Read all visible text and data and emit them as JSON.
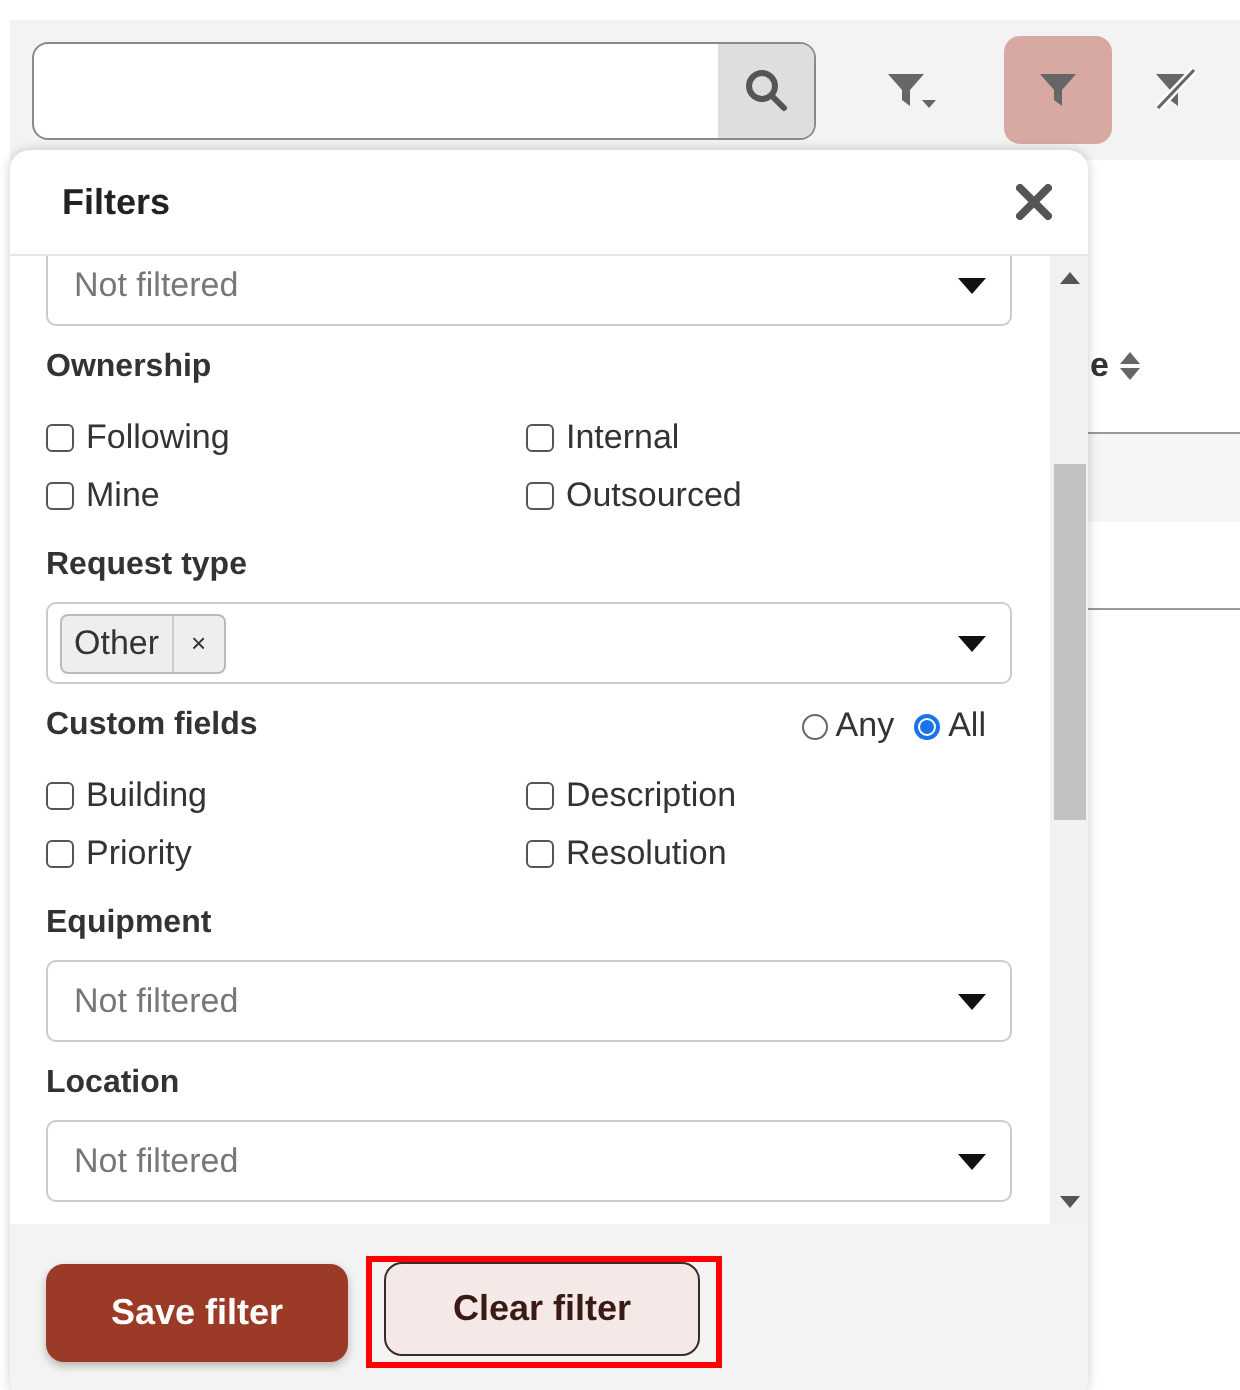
{
  "toolbar": {
    "search_button": {
      "kind": "search"
    },
    "buttons": [
      {
        "kind": "filter-menu",
        "selected": false
      },
      {
        "kind": "filter",
        "selected": true
      },
      {
        "kind": "clear-filter",
        "selected": false
      }
    ]
  },
  "table": {
    "columns": [
      {
        "label": "e",
        "sortable": true
      }
    ]
  },
  "filters_panel": {
    "title": "Filters",
    "sections": [
      {
        "kind": "select",
        "value": "Not filtered"
      },
      {
        "kind": "checkboxes",
        "label": "Ownership",
        "options": [
          {
            "label": "Following",
            "checked": false
          },
          {
            "label": "Internal",
            "checked": false
          },
          {
            "label": "Mine",
            "checked": false
          },
          {
            "label": "Outsourced",
            "checked": false
          }
        ]
      },
      {
        "kind": "tags",
        "label": "Request type",
        "tags": [
          {
            "label": "Other",
            "remove": "×"
          }
        ]
      },
      {
        "kind": "checkboxes",
        "label": "Custom fields",
        "match": [
          {
            "label": "Any",
            "selected": false
          },
          {
            "label": "All",
            "selected": true
          }
        ],
        "options": [
          {
            "label": "Building",
            "checked": false
          },
          {
            "label": "Description",
            "checked": false
          },
          {
            "label": "Priority",
            "checked": false
          },
          {
            "label": "Resolution",
            "checked": false
          }
        ]
      },
      {
        "kind": "select",
        "label": "Equipment",
        "value": "Not filtered"
      },
      {
        "kind": "select",
        "label": "Location",
        "value": "Not filtered"
      }
    ],
    "buttons": [
      {
        "label": "Save filter",
        "kind": "primary",
        "highlighted": false
      },
      {
        "label": "Clear filter",
        "kind": "secondary",
        "highlighted": true
      }
    ]
  }
}
